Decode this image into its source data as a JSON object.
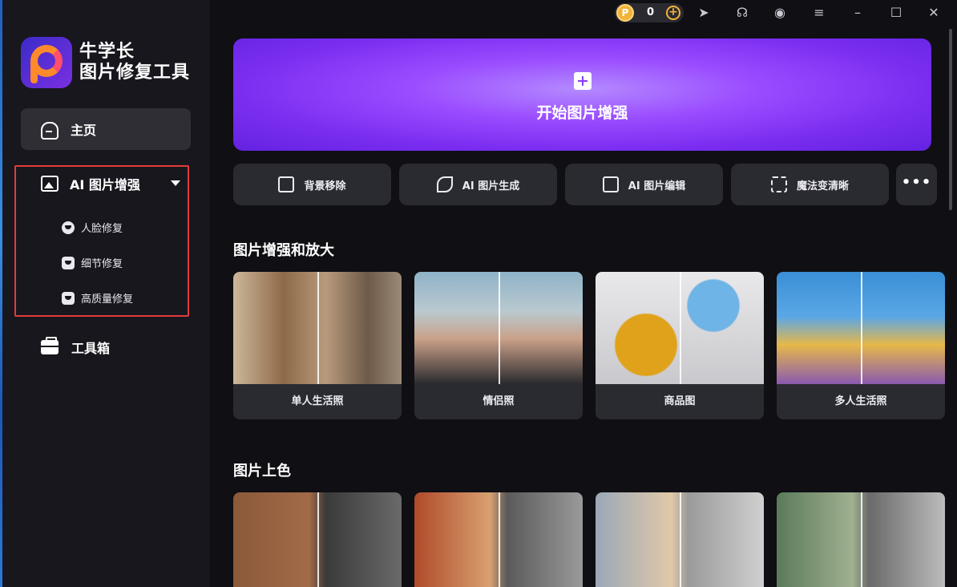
{
  "app": {
    "name_line1": "牛学长",
    "name_line2": "图片修复工具"
  },
  "titlebar": {
    "points_value": "0",
    "coin_glyph": "P"
  },
  "sidebar": {
    "home_label": "主页",
    "ai_enhance_label": "AI 图片增强",
    "sub_items": [
      {
        "label": "人脸修复",
        "icon": "face-icon"
      },
      {
        "label": "细节修复",
        "icon": "detail-image-icon"
      },
      {
        "label": "高质量修复",
        "icon": "quality-icon"
      }
    ],
    "toolbox_label": "工具箱"
  },
  "hero": {
    "title": "开始图片增强"
  },
  "tools": [
    {
      "label": "背景移除",
      "icon": "background-remove-icon"
    },
    {
      "label": "AI 图片生成",
      "icon": "magic-wand-icon"
    },
    {
      "label": "AI 图片编辑",
      "icon": "image-edit-icon"
    },
    {
      "label": "魔法变清晰",
      "icon": "expand-icon"
    }
  ],
  "section1": {
    "title": "图片增强和放大",
    "cards": [
      {
        "caption": "单人生活照"
      },
      {
        "caption": "情侣照"
      },
      {
        "caption": "商品图"
      },
      {
        "caption": "多人生活照"
      }
    ]
  },
  "section2": {
    "title": "图片上色"
  },
  "colors": {
    "accent_purple": "#8a3cf5",
    "highlight_red": "#e23b3b",
    "coin_gold": "#f2b33a"
  }
}
